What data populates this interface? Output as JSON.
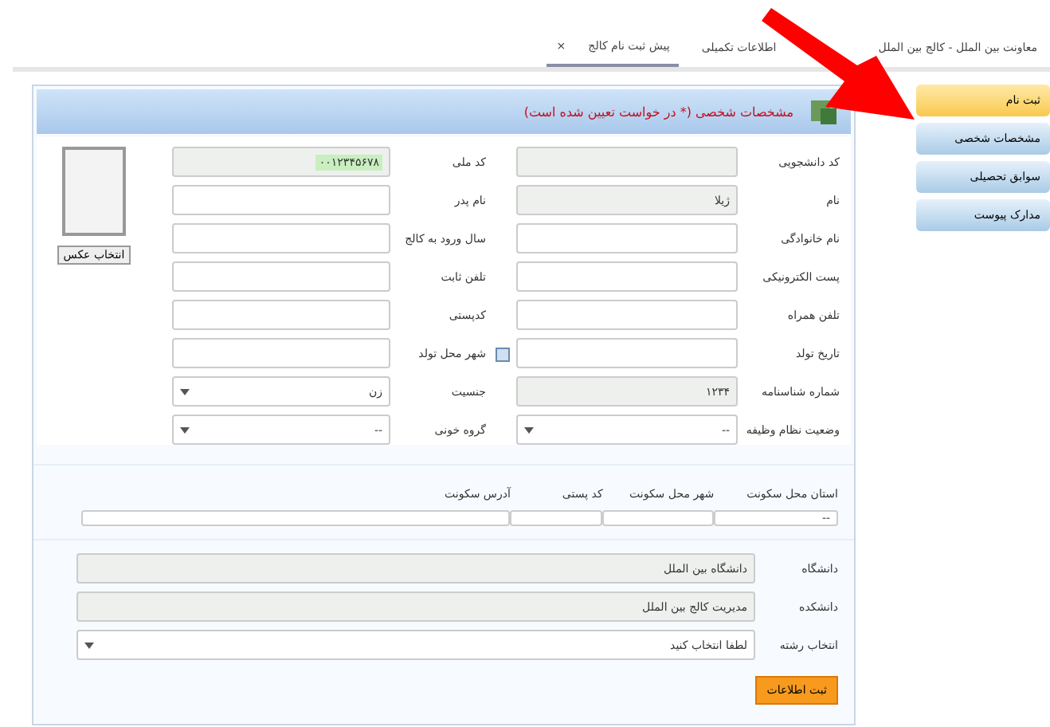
{
  "top_menu": {
    "items": [
      {
        "label": "معاونت بین الملل - کالج بین الملل"
      },
      {
        "label": "اطلاعات تکمیلی"
      }
    ],
    "tabs": [
      {
        "label": "پیش ثبت نام کالج",
        "close": "×",
        "selected": true
      }
    ]
  },
  "side_nav": [
    {
      "label": "ثبت نام",
      "selected": true
    },
    {
      "label": "مشخصات شخصی",
      "selected": false
    },
    {
      "label": "سوابق تحصیلی",
      "selected": false
    },
    {
      "label": "مدارک پیوست",
      "selected": false
    }
  ],
  "panel": {
    "title": "مشخصات شخصی (* در خواست تعیین شده است)",
    "photo_button": "انتخاب عکس",
    "right_fields": [
      {
        "label": "کد دانشجویی",
        "kind": "readonly"
      },
      {
        "label": "نام",
        "value": "ژیلا",
        "kind": "readonly"
      },
      {
        "label": "نام خانوادگی",
        "kind": "text"
      },
      {
        "label": "پست الکترونیکی",
        "kind": "text"
      },
      {
        "label": "تلفن همراه",
        "kind": "text"
      },
      {
        "label": "تاریخ تولد",
        "kind": "date"
      },
      {
        "label": "شماره شناسنامه",
        "value": "۱۲۳۴",
        "kind": "readonly"
      },
      {
        "label": "وضعیت نظام وظیفه",
        "value": "--",
        "kind": "select"
      }
    ],
    "left_fields": [
      {
        "label": "کد ملی",
        "value": "۰۰۱۲۳۴۵۶۷۸",
        "kind": "highlight"
      },
      {
        "label": "نام پدر",
        "kind": "text"
      },
      {
        "label": "سال ورود به کالج",
        "kind": "text"
      },
      {
        "label": "تلفن ثابت",
        "kind": "text"
      },
      {
        "label": "کدپستی",
        "kind": "text"
      },
      {
        "label": "شهر محل تولد",
        "kind": "text"
      },
      {
        "label": "جنسیت",
        "value": "زن",
        "kind": "select"
      },
      {
        "label": "گروه خونی",
        "value": "--",
        "kind": "select"
      }
    ],
    "address": [
      {
        "label": "استان محل سکونت",
        "value": "--"
      },
      {
        "label": "شهر محل سکونت"
      },
      {
        "label": "کد پستی"
      },
      {
        "label": "آدرس سکونت"
      }
    ],
    "wide_fields": [
      {
        "label": "دانشگاه",
        "value": "دانشگاه بین الملل",
        "kind": "readonly"
      },
      {
        "label": "دانشکده",
        "value": "مدیریت کالج بین الملل",
        "kind": "readonly"
      },
      {
        "label": "انتخاب رشته",
        "value": "لطفا انتخاب کنید",
        "kind": "select"
      }
    ],
    "submit": "ثبت اطلاعات"
  }
}
